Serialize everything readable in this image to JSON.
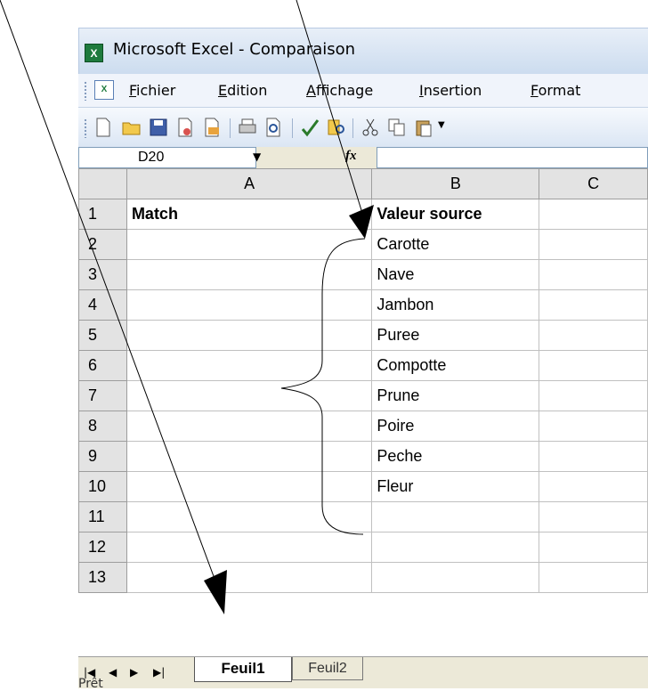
{
  "window": {
    "title": "Microsoft Excel - Comparaison",
    "app_icon": "excel-icon"
  },
  "menu": {
    "items": [
      "Fichier",
      "Edition",
      "Affichage",
      "Insertion",
      "Format"
    ]
  },
  "formula_bar": {
    "name_box": "D20",
    "fx_label": "fx",
    "formula": ""
  },
  "sheet": {
    "columns": [
      "A",
      "B",
      "C"
    ],
    "rows": [
      {
        "num": "1",
        "a": "Match",
        "b": "Valeur source"
      },
      {
        "num": "2",
        "a": "",
        "b": "Carotte"
      },
      {
        "num": "3",
        "a": "",
        "b": "Nave"
      },
      {
        "num": "4",
        "a": "",
        "b": "Jambon"
      },
      {
        "num": "5",
        "a": "",
        "b": "Puree"
      },
      {
        "num": "6",
        "a": "",
        "b": "Compotte"
      },
      {
        "num": "7",
        "a": "",
        "b": "Prune"
      },
      {
        "num": "8",
        "a": "",
        "b": "Poire"
      },
      {
        "num": "9",
        "a": "",
        "b": "Peche"
      },
      {
        "num": "10",
        "a": "",
        "b": "Fleur"
      },
      {
        "num": "11",
        "a": "",
        "b": ""
      },
      {
        "num": "12",
        "a": "",
        "b": ""
      },
      {
        "num": "13",
        "a": "",
        "b": ""
      }
    ]
  },
  "tabs": [
    "Feuil1",
    "Feuil2"
  ],
  "status": {
    "text": "Prêt"
  },
  "colors": {
    "excel_green": "#1e7a3d",
    "header_gray": "#e3e3e3",
    "title_blue": "#ccdcef"
  }
}
